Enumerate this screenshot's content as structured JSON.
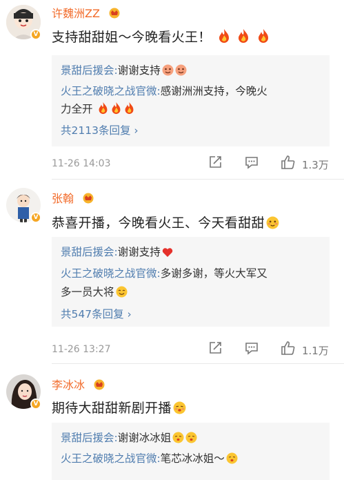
{
  "comments": [
    {
      "username": "许魏洲ZZ",
      "text": "支持甜甜姐～今晚看火王！",
      "replies": [
        {
          "name": "景甜后援会:",
          "text": "谢谢支持"
        },
        {
          "name": "火王之破晓之战官微:",
          "text": "感谢洲洲支持，今晚火",
          "text2": "力全开"
        }
      ],
      "more": "共2113条回复 ›",
      "time": "11-26 14:03",
      "likes": "1.3万"
    },
    {
      "username": "张翰",
      "text": "恭喜开播，今晚看火王、今天看甜甜",
      "replies": [
        {
          "name": "景甜后援会:",
          "text": "谢谢支持"
        },
        {
          "name": "火王之破晓之战官微:",
          "text": "多谢多谢，等火大军又",
          "text2": "多一员大将"
        }
      ],
      "more": "共547条回复 ›",
      "time": "11-26 13:27",
      "likes": "1.1万"
    },
    {
      "username": "李冰冰",
      "text": "期待大甜甜新剧开播",
      "replies": [
        {
          "name": "景甜后援会:",
          "text": "谢谢冰冰姐"
        },
        {
          "name": "火王之破晓之战官微:",
          "text": "笔芯冰冰姐～"
        }
      ]
    }
  ],
  "colors": {
    "username": "#f26b2a",
    "link": "#507daf",
    "reply_bg": "#f6f6f6",
    "vip": "#f5a623"
  },
  "icons": [
    "fire-emoji",
    "crown-badge",
    "verified-v-badge",
    "share-icon",
    "comment-icon",
    "like-icon",
    "heart-emoji",
    "blush-emoji"
  ]
}
